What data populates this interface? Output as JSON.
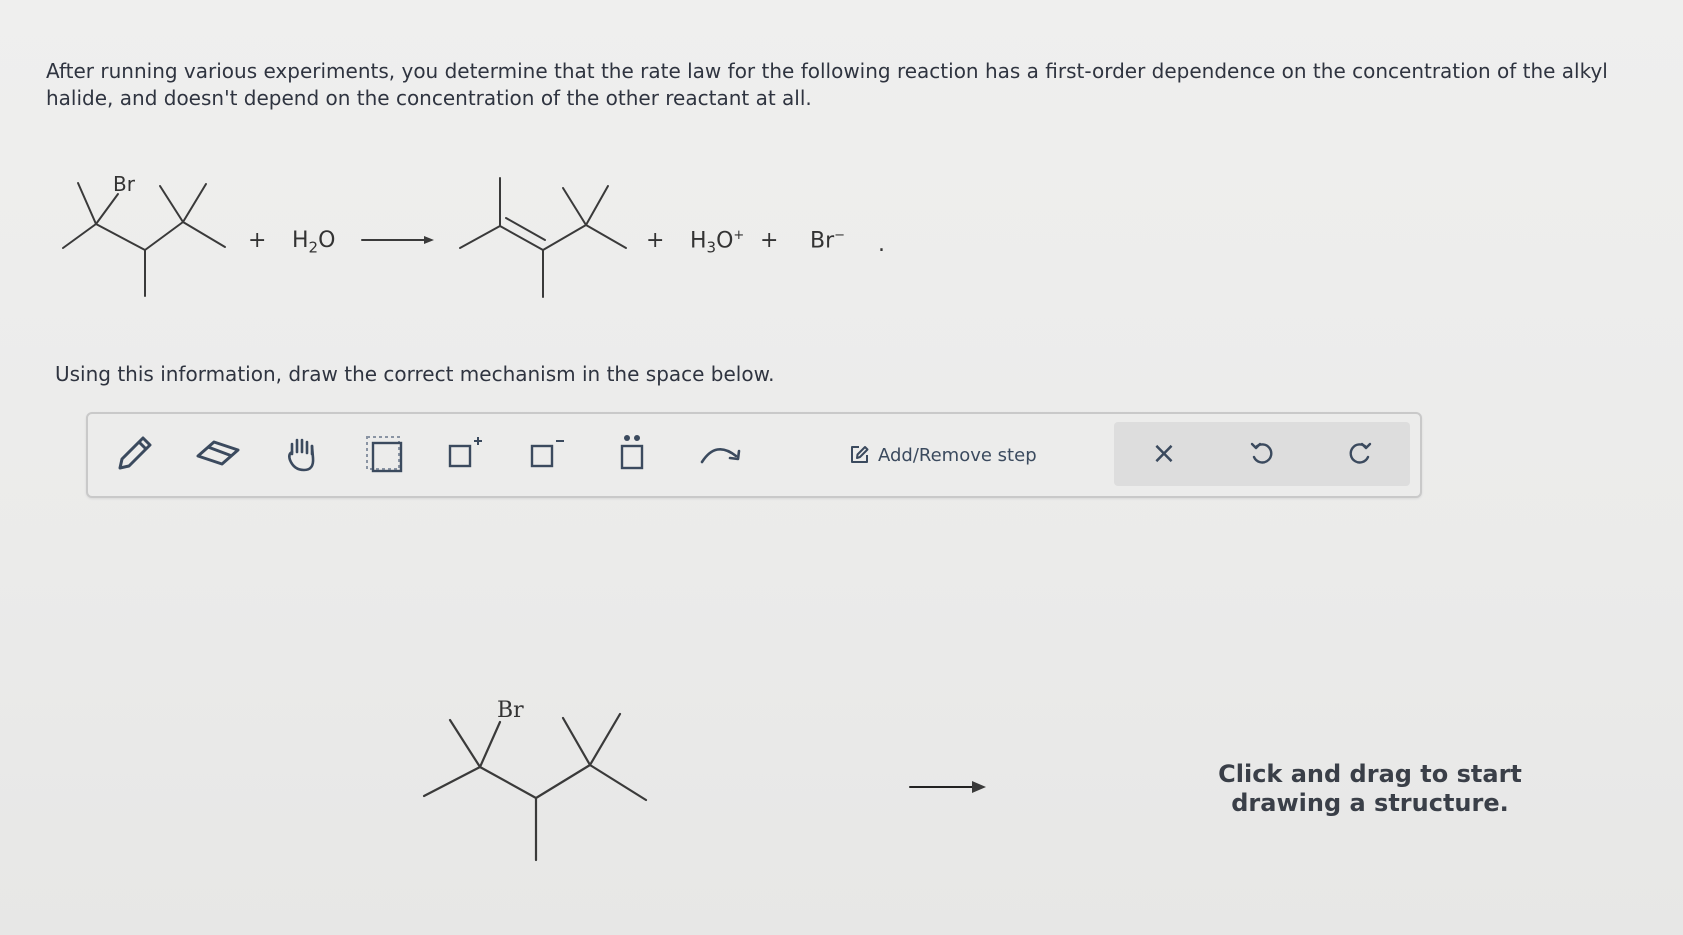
{
  "question": {
    "text": "After running various experiments, you determine that the rate law for the following reaction has a first-order dependence on the concentration of the alkyl halide, and doesn't depend on the concentration of the other reactant at all."
  },
  "reaction": {
    "reactant_label": "Br",
    "plus_1": "+",
    "water_h": "H",
    "water_sub": "2",
    "water_o": "O",
    "plus_2": "+",
    "hydronium_h": "H",
    "hydronium_sub": "3",
    "hydronium_o": "O",
    "hydronium_charge": "+",
    "plus_3": "+",
    "bromide": "Br",
    "bromide_charge": "−",
    "period": "."
  },
  "instruction": "Using this information, draw the correct mechanism in the space below.",
  "toolbar": {
    "tools": [
      {
        "name": "pencil-tool",
        "icon": "pencil-icon"
      },
      {
        "name": "eraser-tool",
        "icon": "eraser-icon"
      },
      {
        "name": "move-tool",
        "icon": "hand-icon"
      },
      {
        "name": "select-tool",
        "icon": "selection-box-icon"
      },
      {
        "name": "positive-charge-tool",
        "icon": "box-plus-icon"
      },
      {
        "name": "negative-charge-tool",
        "icon": "box-minus-icon"
      },
      {
        "name": "lone-pair-tool",
        "icon": "box-dots-icon"
      },
      {
        "name": "curved-arrow-tool",
        "icon": "curved-arrow-icon"
      }
    ],
    "step_label": "Add/Remove step",
    "clear_label": "×"
  },
  "canvas": {
    "molecule_label": "Br",
    "hint_line1": "Click and drag to start",
    "hint_line2": "drawing a structure."
  },
  "colors": {
    "accent": "#3b4a5e",
    "text": "#2f3440",
    "toolbar_bg": "#ececeb",
    "group_bg": "#dddddd"
  }
}
